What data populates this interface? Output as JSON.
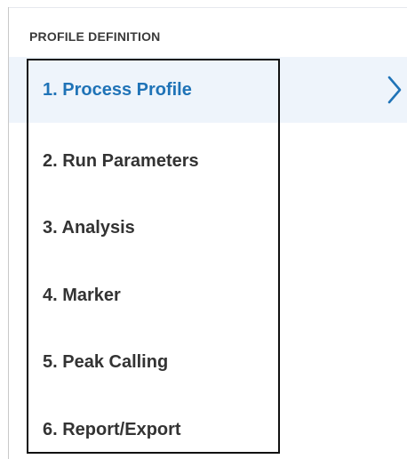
{
  "section": {
    "title": "PROFILE DEFINITION"
  },
  "steps": [
    {
      "label": "1. Process Profile",
      "active": true
    },
    {
      "label": "2. Run Parameters",
      "active": false
    },
    {
      "label": "3. Analysis",
      "active": false
    },
    {
      "label": "4. Marker",
      "active": false
    },
    {
      "label": "5. Peak Calling",
      "active": false
    },
    {
      "label": "6. Report/Export",
      "active": false
    }
  ],
  "icons": {
    "active_indicator": "chevron-right-icon"
  },
  "colors": {
    "active_text": "#1f73b7",
    "active_background": "#eef4fb",
    "inactive_text": "#333333",
    "chevron": "#1f73b7"
  }
}
